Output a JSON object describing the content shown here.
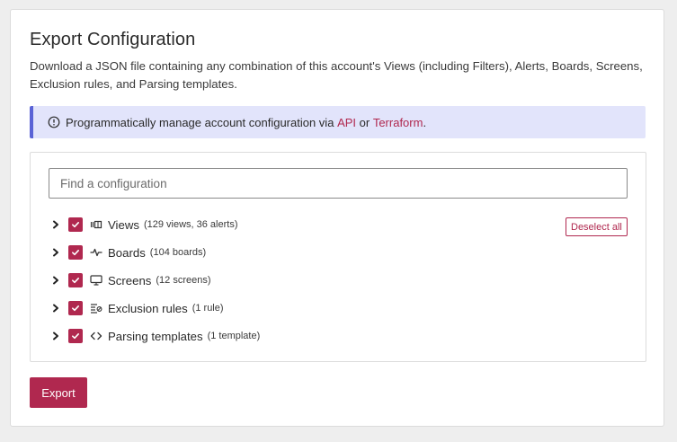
{
  "page": {
    "title": "Export Configuration",
    "description": "Download a JSON file containing any combination of this account's Views (including Filters), Alerts, Boards, Screens, Exclusion rules, and Parsing templates."
  },
  "banner": {
    "icon": "info-circle-icon",
    "text_before": "Programmatically manage account configuration via ",
    "link_api": "API",
    "text_mid": " or ",
    "link_terraform": "Terraform",
    "text_after": "."
  },
  "search": {
    "placeholder": "Find a configuration",
    "value": ""
  },
  "deselect_label": "Deselect all",
  "items": [
    {
      "icon": "views-icon",
      "label": "Views",
      "count": "(129 views, 36 alerts)",
      "checked": true
    },
    {
      "icon": "pulse-icon",
      "label": "Boards",
      "count": "(104 boards)",
      "checked": true
    },
    {
      "icon": "monitor-icon",
      "label": "Screens",
      "count": "(12 screens)",
      "checked": true
    },
    {
      "icon": "exclusion-icon",
      "label": "Exclusion rules",
      "count": "(1 rule)",
      "checked": true
    },
    {
      "icon": "code-icon",
      "label": "Parsing templates",
      "count": "(1 template)",
      "checked": true
    }
  ],
  "export_label": "Export",
  "colors": {
    "accent": "#b0284f",
    "banner_bg": "#e2e4fb",
    "banner_border": "#5a63d6"
  }
}
